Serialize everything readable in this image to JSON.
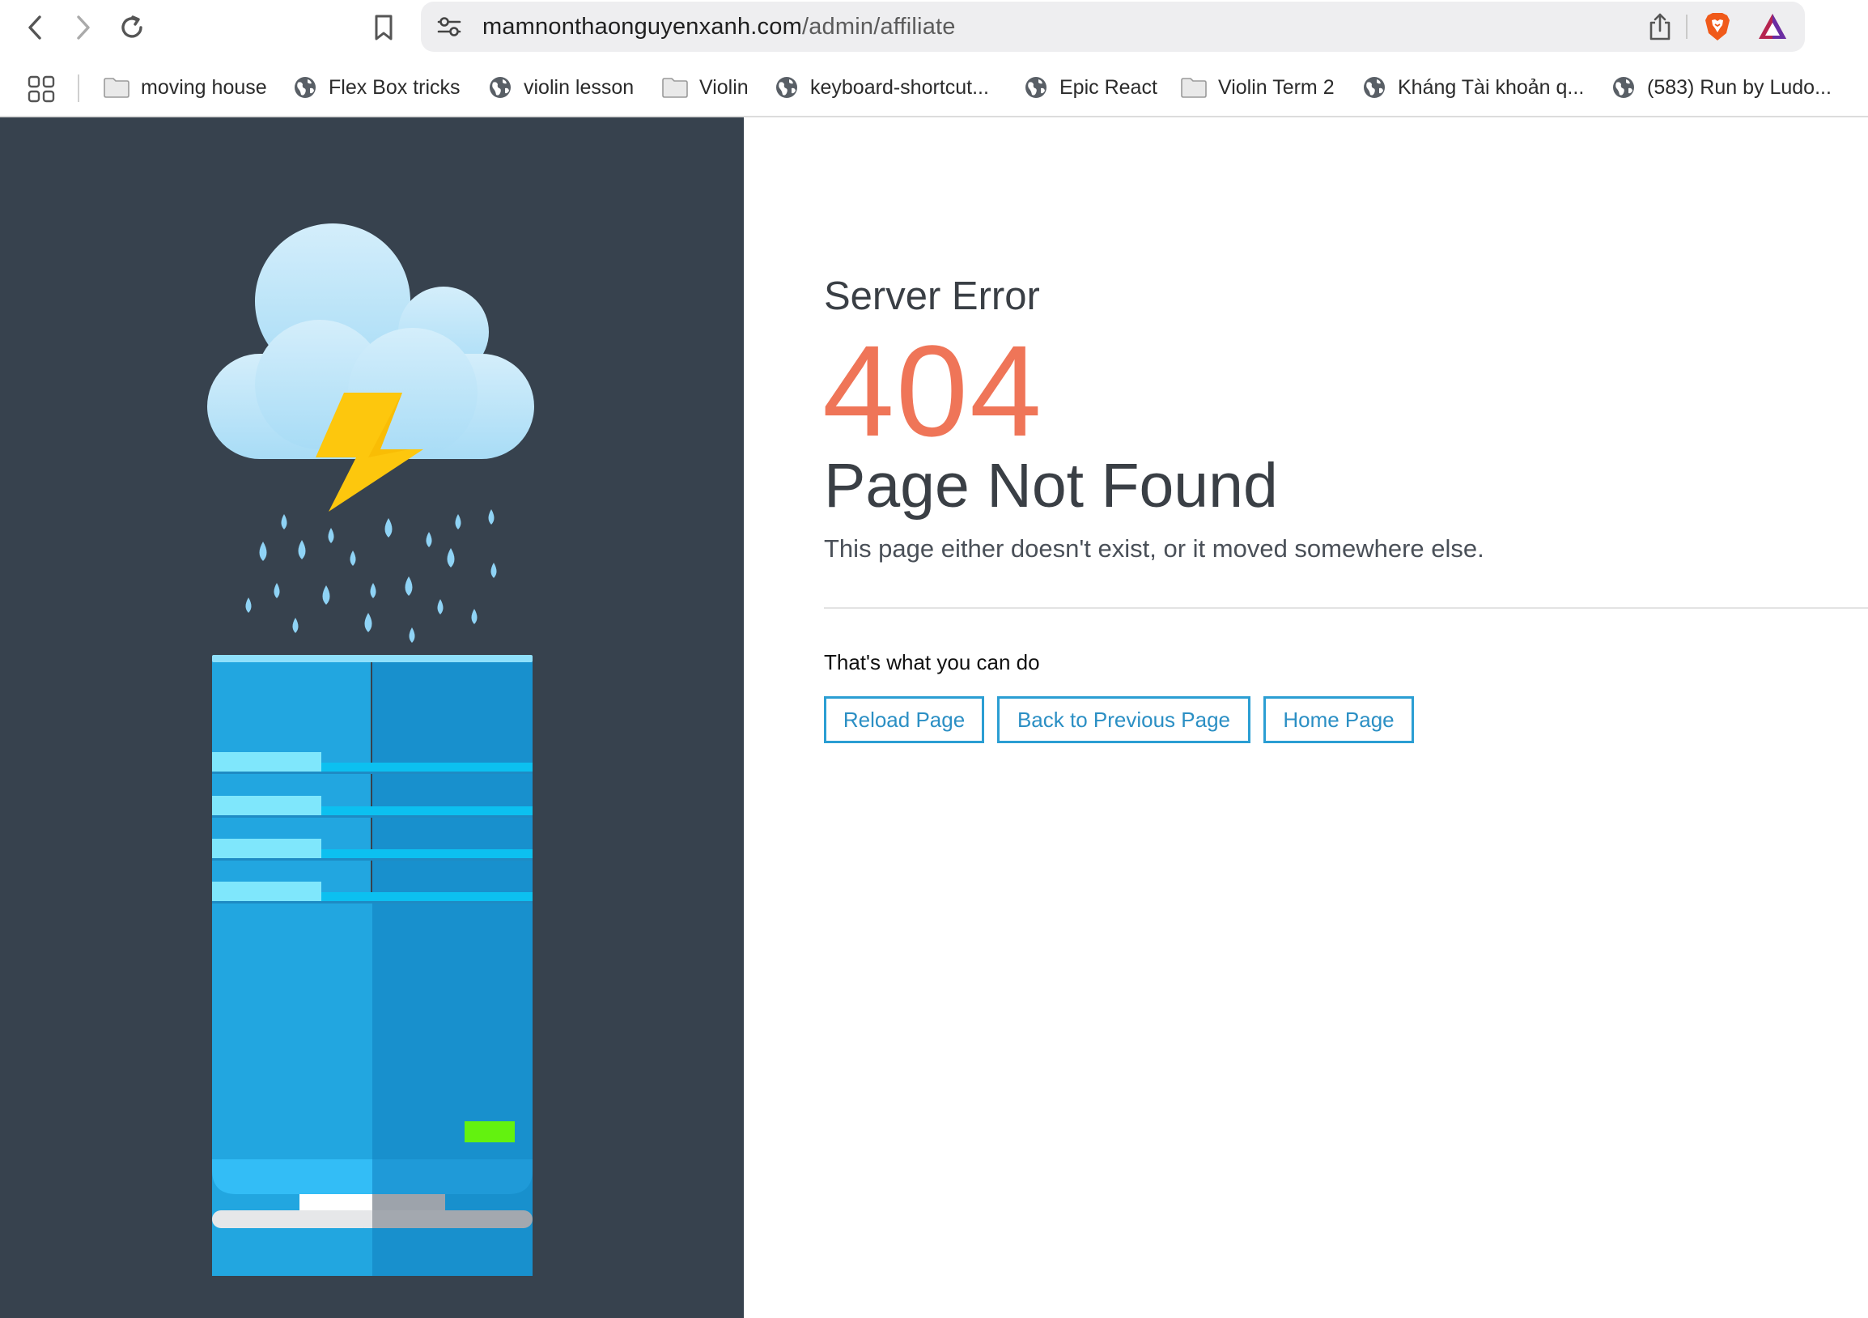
{
  "browser": {
    "url": {
      "host": "mamnonthaonguyenxanh.com",
      "path": "/admin/affiliate"
    },
    "icons": [
      "back-icon",
      "forward-icon",
      "reload-icon",
      "bookmark-icon",
      "site-settings-icon",
      "share-icon",
      "brave-shields-icon",
      "brave-rewards-icon"
    ]
  },
  "bookmarks": [
    {
      "label": "moving house",
      "icon": "folder-icon"
    },
    {
      "label": "Flex Box tricks",
      "icon": "globe-icon"
    },
    {
      "label": "violin lesson",
      "icon": "globe-icon"
    },
    {
      "label": "Violin",
      "icon": "folder-icon"
    },
    {
      "label": "keyboard-shortcut...",
      "icon": "globe-icon"
    },
    {
      "label": "Epic React",
      "icon": "globe-icon"
    },
    {
      "label": "Violin Term 2",
      "icon": "folder-icon"
    },
    {
      "label": "Kháng Tài khoản q...",
      "icon": "globe-icon"
    },
    {
      "label": "(583) Run by Ludo...",
      "icon": "globe-icon"
    }
  ],
  "page": {
    "server_error": "Server Error",
    "code": "404",
    "title": "Page Not Found",
    "description": "This page either doesn't exist, or it moved somewhere else.",
    "actions_heading": "That's what you can do",
    "actions": {
      "reload": "Reload Page",
      "back": "Back to Previous Page",
      "home": "Home Page"
    }
  },
  "colors": {
    "left_panel": "#37424e",
    "error_code": "#ef7558",
    "button_border": "#2b9ed3",
    "server_light": "#22a6e0",
    "server_dark": "#1890cd",
    "status_led": "#63f20f",
    "lightning": "#fdc70d",
    "cloud": "#b9e3f8"
  }
}
